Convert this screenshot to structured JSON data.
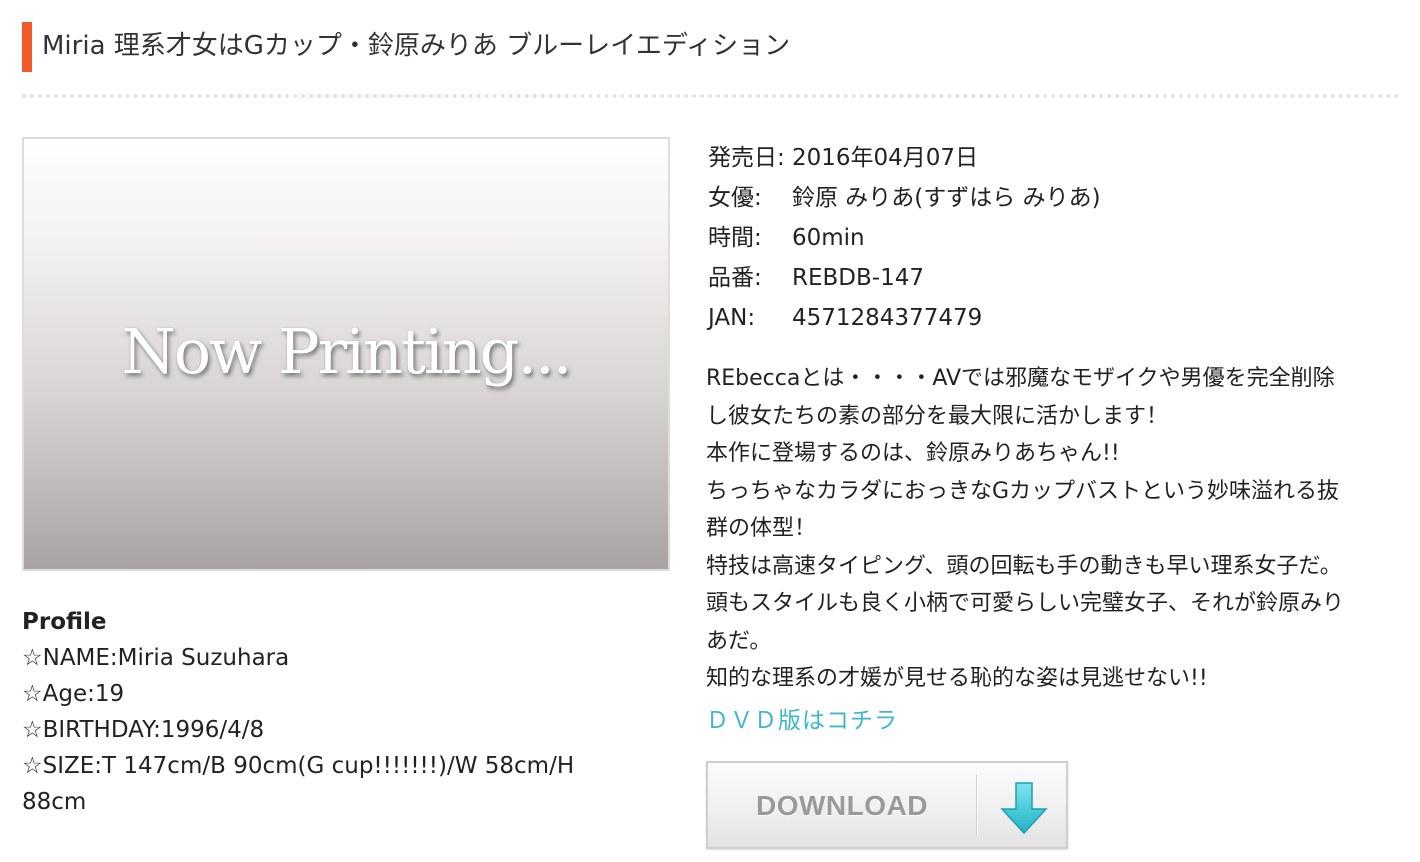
{
  "header": {
    "title": "Miria 理系才女はGカップ・鈴原みりあ ブルーレイエディション"
  },
  "image": {
    "placeholder_text": "Now Printing..."
  },
  "info": {
    "rows": [
      {
        "label": "発売日:",
        "value": "2016年04月07日"
      },
      {
        "label": "女優:",
        "value": "鈴原 みりあ(すずはら みりあ)"
      },
      {
        "label": "時間:",
        "value": "60min"
      },
      {
        "label": "品番:",
        "value": "REBDB-147"
      },
      {
        "label": "JAN:",
        "value": "4571284377479"
      }
    ]
  },
  "description": {
    "lines": [
      "REbeccaとは・・・・AVでは邪魔なモザイクや男優を完全削除",
      "し彼女たちの素の部分を最大限に活かします！",
      "本作に登場するのは、鈴原みりあちゃん!!",
      "ちっちゃなカラダにおっきなGカップバストという妙味溢れる抜",
      "群の体型！",
      "特技は高速タイピング、頭の回転も手の動きも早い理系女子だ。",
      "頭もスタイルも良く小柄で可愛らしい完璧女子、それが鈴原みり",
      "あだ。",
      "知的な理系の才媛が見せる恥的な姿は見逃せない!!"
    ]
  },
  "dvd_link": {
    "label": "ＤＶＤ版はコチラ",
    "color": "#3fb7cc"
  },
  "download": {
    "label": "DOWNLOAD",
    "icon": "down-arrow-icon",
    "icon_color": "#2ec4d6"
  },
  "profile": {
    "heading": "Profile",
    "lines": [
      "☆NAME:Miria Suzuhara",
      "☆Age:19",
      "☆BIRTHDAY:1996/4/8",
      "☆SIZE:T 147cm/B 90cm(G cup!!!!!!!)/W 58cm/H",
      "88cm"
    ]
  },
  "colors": {
    "accent": "#f05a28",
    "link": "#3fb7cc"
  }
}
